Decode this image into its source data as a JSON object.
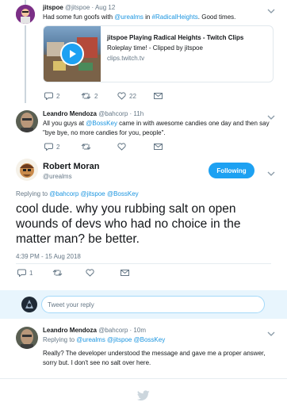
{
  "tweet1": {
    "name": "jitspoe",
    "handle": "@jitspoe",
    "date": "Aug 12",
    "text_prefix": "Had some fun goofs with ",
    "mention": "@urealms",
    "text_mid": " in ",
    "hashtag": "#RadicalHeights",
    "text_suffix": ".  Good times.",
    "card": {
      "title": "jitspoe Playing Radical Heights - Twitch Clips",
      "description": "Roleplay time! - Clipped by jitspoe",
      "domain": "clips.twitch.tv"
    },
    "replies": "2",
    "retweets": "2",
    "likes": "22"
  },
  "tweet2": {
    "name": "Leandro Mendoza",
    "handle": "@bahcorp",
    "date": "11h",
    "line1_prefix": "All you guys at ",
    "mention": "@BossKey",
    "line1_suffix": " came in with awesome candies one day and then say",
    "line2": "\"bye bye, no more candies for you, people\".",
    "replies": "2"
  },
  "main": {
    "name": "Robert Moran",
    "handle": "@urealms",
    "follow_label": "Following",
    "replying_prefix": "Replying to ",
    "replying_to": "@bahcorp @jitspoe @BossKey",
    "text": "cool dude. why you rubbing salt on open wounds of devs who had no choice in the matter man? be better.",
    "timestamp": "4:39 PM - 15 Aug 2018",
    "replies": "1"
  },
  "reply_box": {
    "placeholder": "Tweet your reply"
  },
  "tweet3": {
    "name": "Leandro Mendoza",
    "handle": "@bahcorp",
    "date": "10m",
    "replying_prefix": "Replying to ",
    "replying_to": "@urealms @jitspoe @BossKey",
    "line1": "Really? The developer understood the message and gave me a proper answer,",
    "line2": "sorry but.  I don't see no salt over here."
  },
  "colors": {
    "accent": "#1da1f2",
    "link": "#1b95e0",
    "muted": "#657786"
  }
}
